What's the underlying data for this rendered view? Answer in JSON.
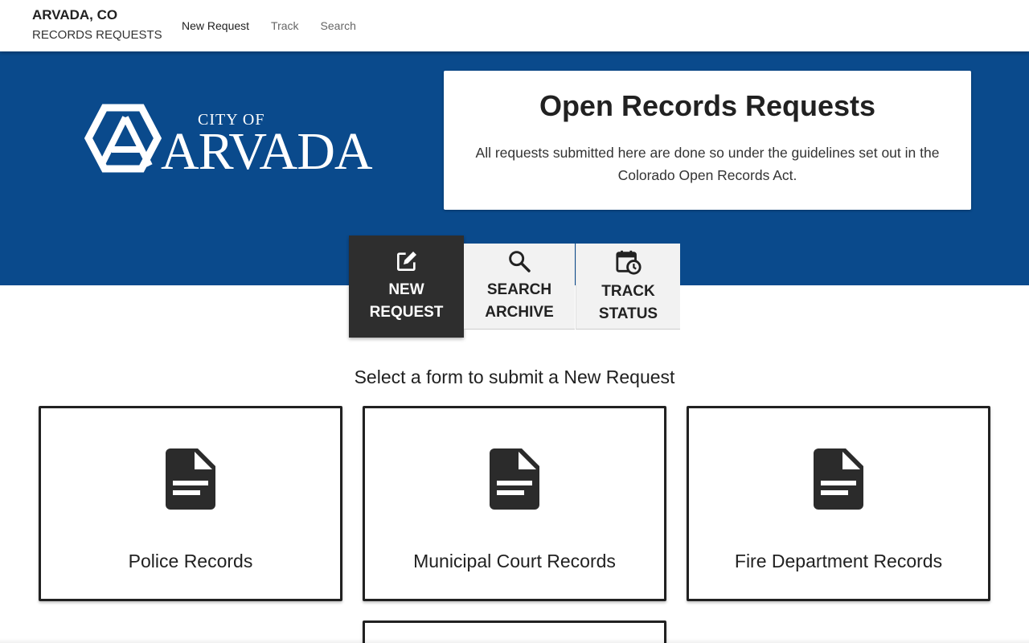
{
  "header": {
    "brand_name": "ARVADA, CO",
    "brand_sub": "RECORDS REQUESTS",
    "nav": [
      "New Request",
      "Track",
      "Search"
    ]
  },
  "hero": {
    "logo_small": "CITY OF",
    "logo_big": "ARVADA",
    "title": "Open Records Requests",
    "description": "All requests submitted here are done so under the guidelines set out in the Colorado Open Records Act."
  },
  "actions": {
    "new_line1": "NEW",
    "new_line2": "REQUEST",
    "search_line1": "SEARCH",
    "search_line2": "ARCHIVE",
    "track_line1": "TRACK",
    "track_line2": "STATUS"
  },
  "section_title": "Select a form to submit a New Request",
  "forms": [
    "Police Records",
    "Municipal Court Records",
    "Fire Department Records"
  ],
  "icons": {
    "new": "edit-icon",
    "search": "search-icon",
    "track": "calendar-clock-icon",
    "form": "document-icon",
    "logo": "arvada-logo-icon"
  },
  "colors": {
    "hero_bg": "#0a4a8c",
    "active_tab": "#2e2e2e",
    "inactive_tab": "#f2f2f2",
    "text": "#212121"
  }
}
